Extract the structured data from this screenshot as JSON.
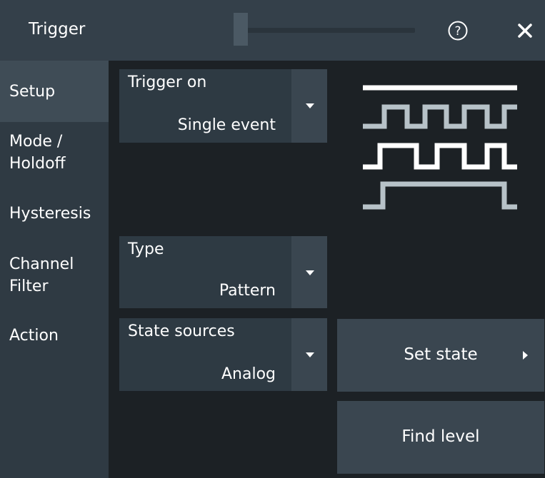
{
  "window": {
    "title": "Trigger"
  },
  "sidebar": {
    "items": [
      {
        "label": "Setup",
        "active": true
      },
      {
        "label": "Mode /\nHoldoff",
        "active": false
      },
      {
        "label": "Hysteresis",
        "active": false
      },
      {
        "label": "Channel\nFilter",
        "active": false
      },
      {
        "label": "Action",
        "active": false
      }
    ]
  },
  "fields": {
    "trigger_on": {
      "label": "Trigger on",
      "value": "Single event"
    },
    "type": {
      "label": "Type",
      "value": "Pattern"
    },
    "state_sources": {
      "label": "State sources",
      "value": "Analog"
    }
  },
  "buttons": {
    "set_state": "Set state",
    "find_level": "Find level"
  },
  "icons": {
    "help": "help-circle-icon",
    "close": "close-icon",
    "submenu": "triangle-right-icon",
    "dropdown": "triangle-down-icon"
  },
  "colors": {
    "background": "#1c2125",
    "panel": "#2e3a43",
    "button": "#3a4650",
    "active_tab": "#3f4c56",
    "waveform_white": "#ffffff",
    "waveform_gray": "#b7c2c8"
  }
}
